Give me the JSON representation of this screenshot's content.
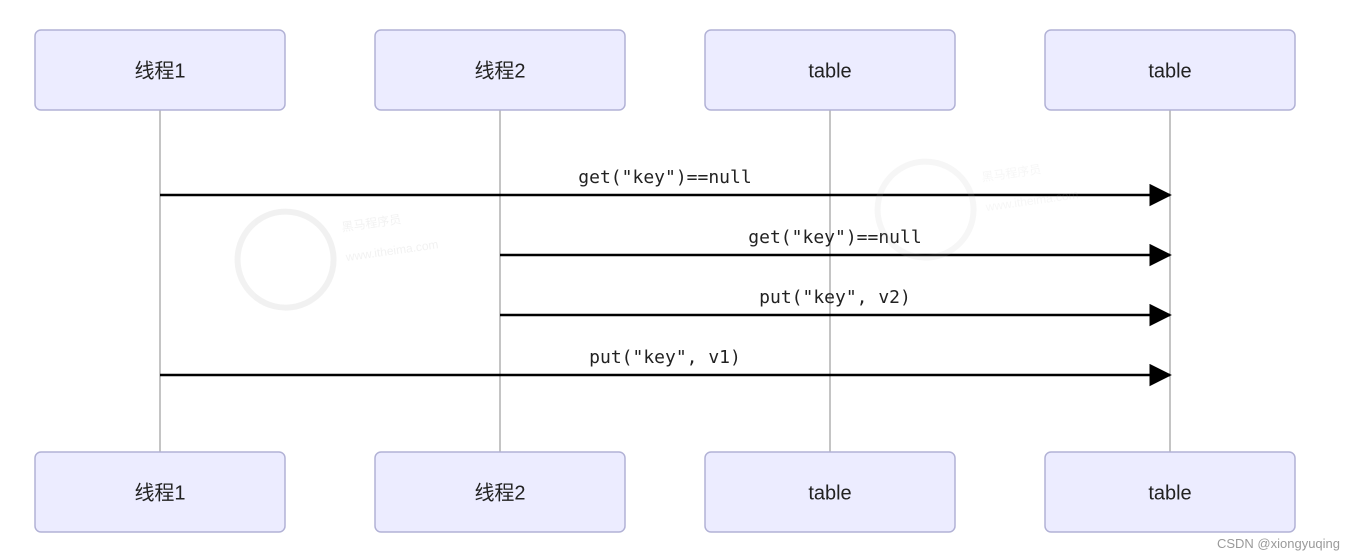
{
  "participants": {
    "p1": "线程1",
    "p2": "线程2",
    "p3": "table",
    "p4": "table"
  },
  "messages": {
    "m1": "get(\"key\")==null",
    "m2": "get(\"key\")==null",
    "m3": "put(\"key\", v2)",
    "m4": "put(\"key\", v1)"
  },
  "credit": "CSDN @xiongyuqing",
  "watermark": {
    "line1": "黑马程序员",
    "line2": "www.itheima.com"
  }
}
